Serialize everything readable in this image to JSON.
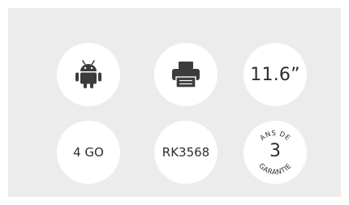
{
  "features": {
    "os": {
      "icon": "android-icon"
    },
    "printer": {
      "icon": "printer-icon"
    },
    "screen": {
      "label": "11.6”"
    },
    "memory": {
      "label": "4 GO"
    },
    "chip": {
      "label": "RK3568"
    },
    "warranty": {
      "top_text": "ANS DE",
      "years": "3",
      "bottom_text": "GARANTIE"
    }
  },
  "colors": {
    "panel_background": "#ececec",
    "circle_background": "#ffffff",
    "icon_color": "#3c3c3c"
  }
}
